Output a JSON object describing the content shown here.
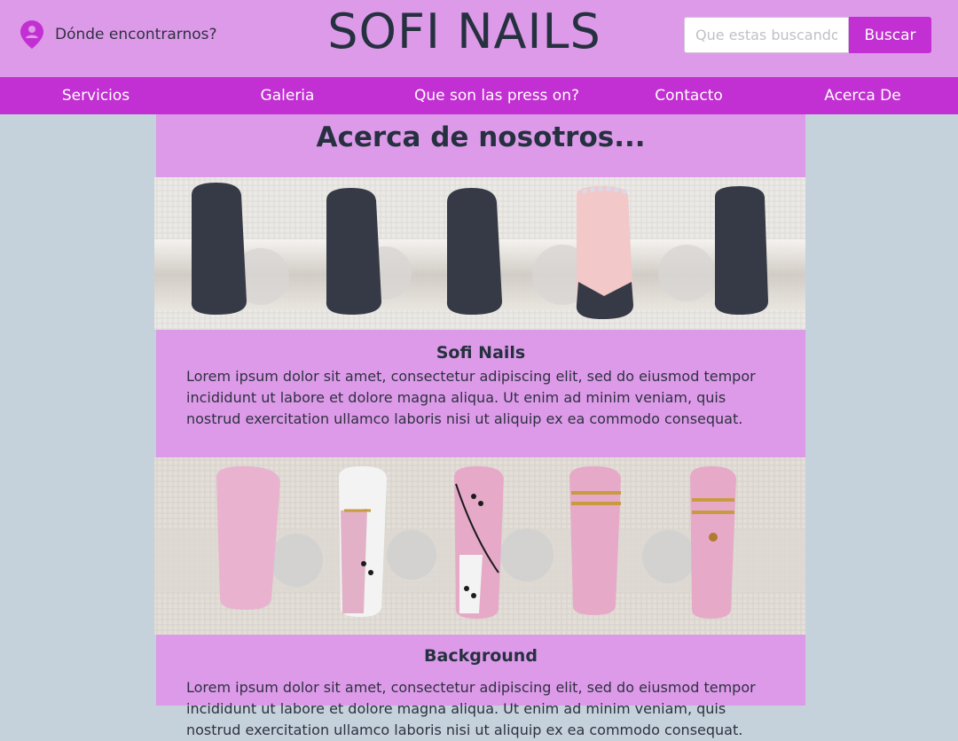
{
  "header": {
    "location_label": "Dónde encontrarnos?",
    "brand": "SOFI NAILS",
    "search_placeholder": "Que estas buscando?",
    "search_button": "Buscar"
  },
  "nav": {
    "items": [
      "Servicios",
      "Galeria",
      "Que son las press on?",
      "Contacto",
      "Acerca De"
    ]
  },
  "page": {
    "title": "Acerca de nosotros...",
    "sections": [
      {
        "title": "Sofi Nails",
        "text": "Lorem ipsum dolor sit amet, consectetur adipiscing elit, sed do eiusmod  tempor incididunt ut labore et dolore magna aliqua. Ut enim ad minim  veniam, quis nostrud exercitation ullamco laboris nisi ut aliquip ex ea  commodo consequat."
      },
      {
        "title": "Background",
        "text": "Lorem ipsum dolor sit amet, consectetur adipiscing elit, sed do eiusmod  tempor incididunt ut labore et dolore magna aliqua. Ut enim ad minim  veniam, quis nostrud exercitation ullamco laboris nisi ut aliquip ex ea  commodo consequat."
      }
    ]
  },
  "colors": {
    "header_bg": "#dd9ae9",
    "nav_bg": "#c22fd2",
    "page_bg": "#c5d1db",
    "text": "#263140"
  },
  "icons": {
    "location": "map-pin-person-icon"
  }
}
